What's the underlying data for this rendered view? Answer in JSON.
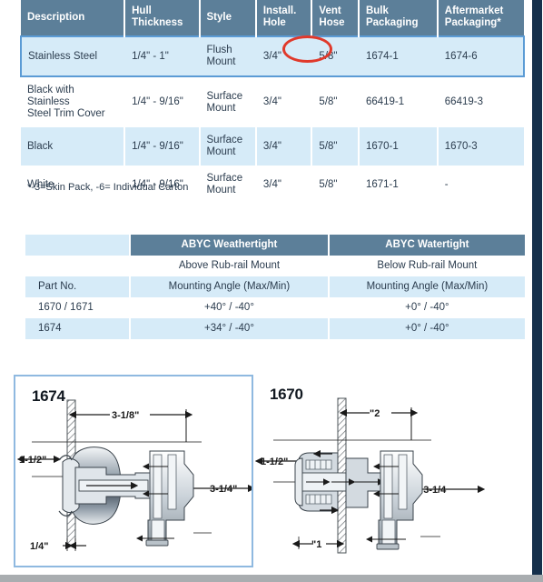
{
  "spec_table": {
    "name": "product-specification-table",
    "headers": [
      "Description",
      "Hull\nThickness",
      "Style",
      "Install.\nHole",
      "Vent\nHose",
      "Bulk\nPackaging",
      "Aftermarket\nPackaging*"
    ],
    "headers_flat": [
      "Description",
      "Hull Thickness",
      "Style",
      "Install. Hole",
      "Vent Hose",
      "Bulk Packaging",
      "Aftermarket Packaging*"
    ],
    "header_lines": [
      [
        "Description",
        ""
      ],
      [
        "Hull",
        "Thickness"
      ],
      [
        "Style",
        ""
      ],
      [
        "Install.",
        "Hole"
      ],
      [
        "Vent",
        "Hose"
      ],
      [
        "Bulk",
        "Packaging"
      ],
      [
        "Aftermarket",
        "Packaging*"
      ]
    ],
    "rows": [
      {
        "description": "Stainless Steel",
        "hull_thickness": "1/4\" - 1\"",
        "style_line1": "Flush",
        "style_line2": "Mount",
        "install_hole": "3/4\"",
        "vent_hose": "5/8\"",
        "bulk_packaging": "1674-1",
        "aftermarket_packaging": "1674-6",
        "highlighted": true,
        "annotated_cell": "install_hole"
      },
      {
        "description_line1": "Black with Stainless",
        "description_line2": "Steel Trim Cover",
        "hull_thickness": "1/4\" - 9/16\"",
        "style_line1": "Surface",
        "style_line2": "Mount",
        "install_hole": "3/4\"",
        "vent_hose": "5/8\"",
        "bulk_packaging": "66419-1",
        "aftermarket_packaging": "66419-3",
        "highlighted": false
      },
      {
        "description": "Black",
        "hull_thickness": "1/4\" - 9/16\"",
        "style_line1": "Surface",
        "style_line2": "Mount",
        "install_hole": "3/4\"",
        "vent_hose": "5/8\"",
        "bulk_packaging": "1670-1",
        "aftermarket_packaging": "1670-3",
        "highlighted": false
      },
      {
        "description": "White",
        "hull_thickness": "1/4\" - 9/16\"",
        "style_line1": "Surface",
        "style_line2": "Mount",
        "install_hole": "3/4\"",
        "vent_hose": "5/8\"",
        "bulk_packaging": "1671-1",
        "aftermarket_packaging": "-",
        "highlighted": false
      }
    ]
  },
  "footnote": "*-3=Skin Pack, -6= Individual Carton",
  "abyc_table": {
    "name": "abyc-mounting-angle-table",
    "corner_label": "",
    "group_headers": [
      "ABYC Weathertight",
      "ABYC Watertight"
    ],
    "mount_row": [
      "",
      "Above Rub-rail Mount",
      "Below Rub-rail Mount"
    ],
    "subheader_row": [
      "Part No.",
      "Mounting Angle (Max/Min)",
      "Mounting Angle (Max/Min)"
    ],
    "rows": [
      {
        "part_no": "1670 / 1671",
        "weathertight": "+40° / -40°",
        "watertight": "+0° / -40°"
      },
      {
        "part_no": "1674",
        "weathertight": "+34° / -40°",
        "watertight": "+0° / -40°"
      }
    ]
  },
  "diagrams": [
    {
      "id": "diagram-1674",
      "title": "1674",
      "highlighted": true,
      "dimensions": {
        "top_horizontal": "3-1/8\"",
        "left_vertical": "1-1/2\"",
        "right_vertical": "3-1/4\"",
        "bottom_left": "1/4\""
      }
    },
    {
      "id": "diagram-1670",
      "title": "1670",
      "highlighted": false,
      "dimensions": {
        "top_horizontal": "\"2",
        "left_vertical": "1-1/2\"",
        "right_vertical": "\"3-1/4",
        "bottom_left": "\"1"
      }
    }
  ],
  "colors": {
    "header_blue": "#5c7f99",
    "row_tint": "#d6ebf8",
    "highlight_border": "#5b9bd5",
    "annotation_red": "#e0392b",
    "edge_bar": "#16304b",
    "bottom_bar": "#a9adb0",
    "text": "#2b3c4e"
  }
}
